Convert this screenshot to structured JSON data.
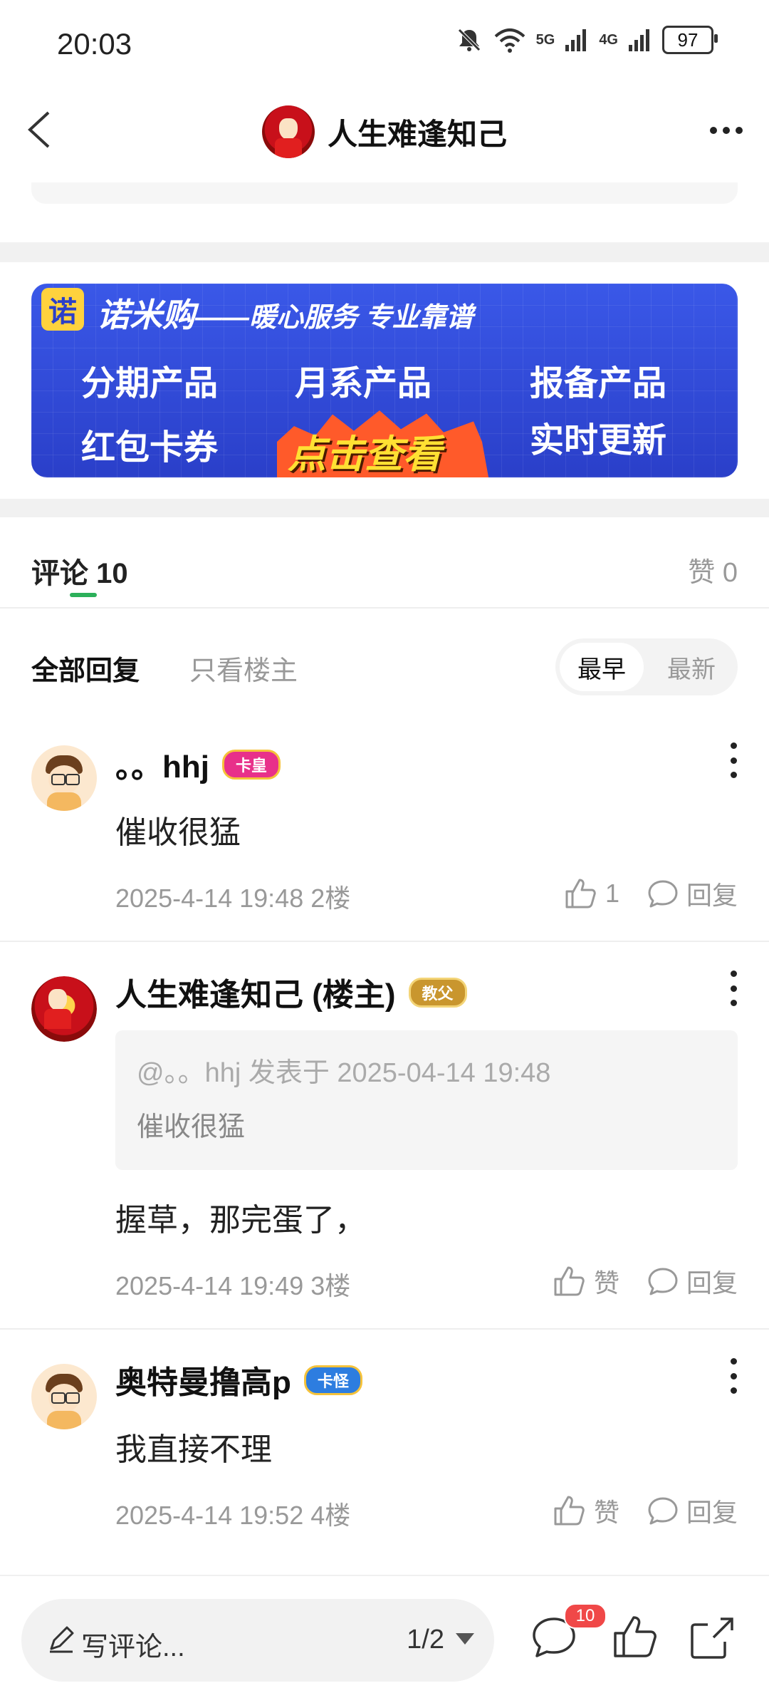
{
  "status_bar": {
    "time": "20:03",
    "signal_5g": "5G",
    "signal_4g": "4G",
    "battery": "97"
  },
  "header": {
    "title": "人生难逢知己"
  },
  "banner": {
    "logo_char": "诺",
    "brand": "诺米购",
    "slogan": "——暖心服务 专业靠谱",
    "items": [
      "分期产品",
      "月系产品",
      "报备产品",
      "红包卡券",
      "实时更新"
    ],
    "cta": "点击查看"
  },
  "tabs": {
    "comments_label": "评论 10",
    "likes_label": "赞 0"
  },
  "filters": {
    "all": "全部回复",
    "op_only": "只看楼主",
    "sort_early": "最早",
    "sort_new": "最新"
  },
  "comments": [
    {
      "name": "。。hhj",
      "badge": "卡皇",
      "text": "催收很猛",
      "meta": "2025-4-14 19:48  2楼",
      "like_label": "1",
      "reply_label": "回复"
    },
    {
      "name": "人生难逢知己 (楼主)",
      "badge": "教父",
      "quote_head": "@。。hhj 发表于 2025-04-14 19:48",
      "quote_body": "催收很猛",
      "text": "握草，那完蛋了，",
      "meta": "2025-4-14 19:49  3楼",
      "like_label": "赞",
      "reply_label": "回复"
    },
    {
      "name": "奥特曼撸高p",
      "badge": "卡怪",
      "text": "我直接不理",
      "meta": "2025-4-14 19:52  4楼",
      "like_label": "赞",
      "reply_label": "回复"
    }
  ],
  "bottom_bar": {
    "placeholder": "写评论...",
    "pager": "1/2",
    "comment_count_badge": "10"
  }
}
